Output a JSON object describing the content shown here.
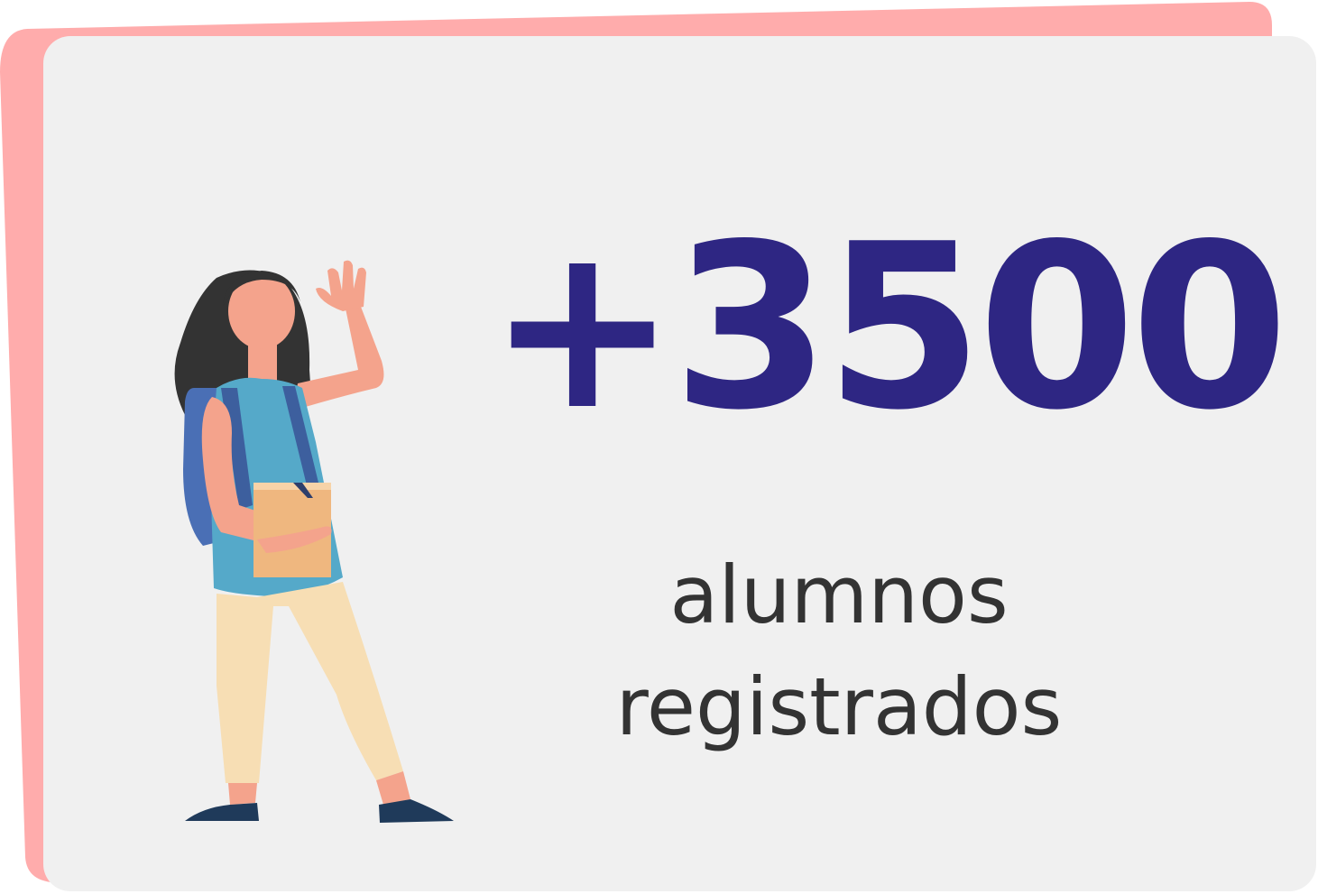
{
  "stat": {
    "value": "+3500",
    "caption_line1": "alumnos",
    "caption_line2": "registrados"
  },
  "illustration": {
    "icon": "student-waving-illustration"
  },
  "colors": {
    "back_card": "#ffacac",
    "front_card": "#f0f0f0",
    "number": "#2e2683",
    "caption": "#333333",
    "shirt": "#55a9c9",
    "backpack": "#4a6fb5",
    "pants": "#f7deb4",
    "skin": "#f4a38c",
    "hair": "#333333",
    "book": "#efb77f",
    "shoes": "#1f3a5a"
  }
}
